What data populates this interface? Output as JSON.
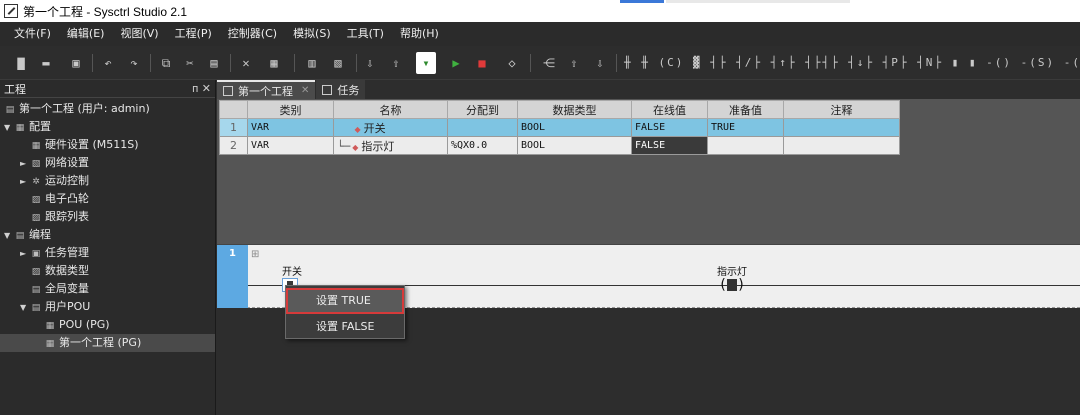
{
  "window": {
    "title": "第一个工程 - Sysctrl Studio 2.1"
  },
  "menu": [
    "文件(F)",
    "编辑(E)",
    "视图(V)",
    "工程(P)",
    "控制器(C)",
    "模拟(S)",
    "工具(T)",
    "帮助(H)"
  ],
  "toolbar": {
    "icons": [
      "new-file-icon",
      "open-folder-icon",
      "save-icon",
      "undo-icon",
      "redo-icon",
      "copy-icon",
      "cut-icon",
      "paste-icon",
      "delete-icon",
      "find-icon",
      "build-icon",
      "rebuild-icon",
      "download-icon",
      "upload-icon",
      "online-icon",
      "run-icon",
      "stop-icon",
      "step-icon",
      "force-icon",
      "move-up-icon",
      "move-down-icon",
      "ladder-edit-icons"
    ]
  },
  "project_panel": {
    "header": "工程",
    "header_icons": "ᴨ ✕",
    "root": "第一个工程 (用户: admin)",
    "config": "配置",
    "config_children": [
      "硬件设置 (M511S)",
      "网络设置",
      "运动控制",
      "电子凸轮",
      "跟踪列表"
    ],
    "program": "编程",
    "program_children": [
      "任务管理",
      "数据类型",
      "全局变量",
      "用户POU"
    ],
    "pou_children": [
      "POU (PG)",
      "第一个工程 (PG)"
    ]
  },
  "tabs": [
    {
      "label": "第一个工程",
      "active": true
    },
    {
      "label": "任务",
      "active": false
    }
  ],
  "var_table": {
    "columns": [
      "",
      "类别",
      "名称",
      "分配到",
      "数据类型",
      "在线值",
      "准备值",
      "注释"
    ],
    "rows": [
      {
        "num": "1",
        "category": "VAR",
        "name": "开关",
        "assign": "",
        "type": "BOOL",
        "online": "FALSE",
        "prepare": "TRUE",
        "comment": ""
      },
      {
        "num": "2",
        "category": "VAR",
        "name": "指示灯",
        "assign": "%QX0.0",
        "type": "BOOL",
        "online": "FALSE",
        "prepare": "",
        "comment": ""
      }
    ]
  },
  "ladder": {
    "network_number": "1",
    "expand_glyph": "⊞",
    "contact_label": "开关",
    "coil_label": "指示灯"
  },
  "context_menu": {
    "items": [
      "设置 TRUE",
      "设置 FALSE"
    ],
    "highlighted": "设置 TRUE"
  },
  "colors": {
    "selected_row": "#7ec4e2",
    "network_number_bg": "#5da9e2",
    "highlight_outline": "#d63a3a"
  }
}
